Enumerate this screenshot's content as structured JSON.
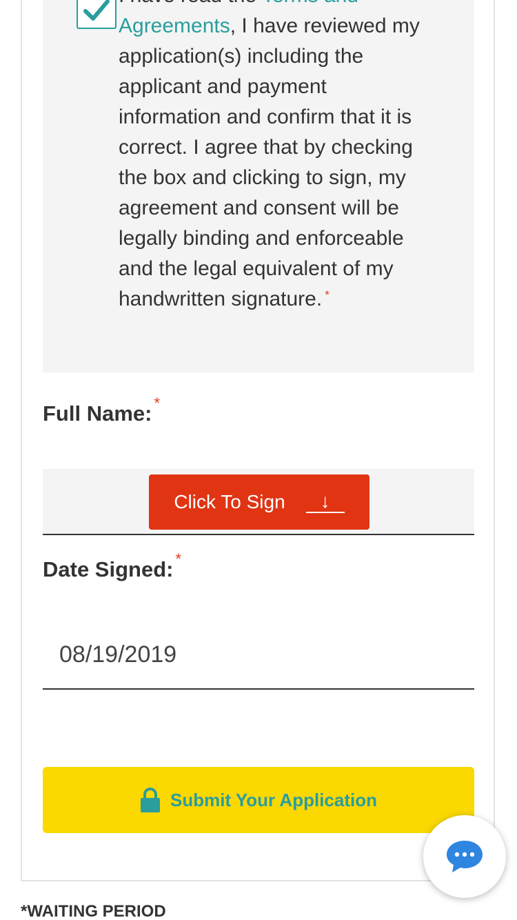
{
  "consent": {
    "text_before_link": "I have read the ",
    "link_text": "Terms and Agreements",
    "text_after_link": ", I have reviewed my application(s) including the applicant and payment information and confirm that it is correct. I agree that by checking the box and clicking to sign, my agreement and consent will be legally binding and enforceable and the legal equivalent of my handwritten signature.",
    "required_mark": "*",
    "checked": true
  },
  "full_name": {
    "label": "Full Name:",
    "required_mark": "*",
    "sign_button_label": "Click To Sign",
    "sign_button_arrow": "↓"
  },
  "date_signed": {
    "label": "Date Signed:",
    "required_mark": "*",
    "value": "08/19/2019"
  },
  "submit": {
    "label": "Submit Your Application",
    "icon": "lock-icon"
  },
  "chat": {
    "icon": "chat-bubble-icon"
  },
  "footer": {
    "note": "*WAITING PERIOD"
  },
  "colors": {
    "accent": "#2a9d9d",
    "sign_button": "#e03413",
    "submit_button": "#fbd800",
    "chat_icon": "#2e86e0",
    "required": "#e23a1a"
  }
}
